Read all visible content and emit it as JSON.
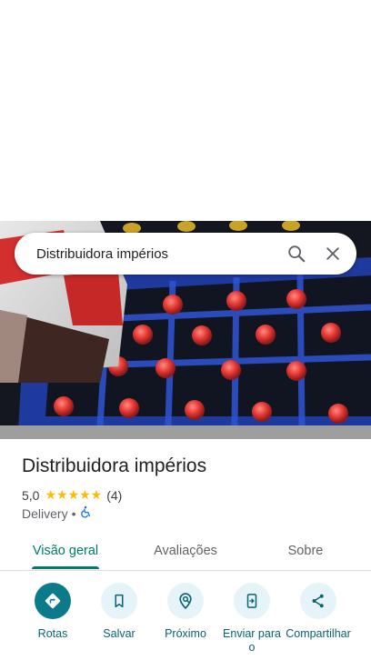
{
  "search": {
    "query": "Distribuidora impérios",
    "search_icon": "search-icon",
    "close_icon": "close-icon"
  },
  "place": {
    "name": "Distribuidora impérios",
    "rating": "5,0",
    "stars": "★★★★★",
    "review_count": "(4)",
    "category": "Delivery",
    "separator": "•",
    "accessibility_icon": "wheelchair-icon"
  },
  "tabs": [
    {
      "label": "Visão geral",
      "active": true
    },
    {
      "label": "Avaliações",
      "active": false
    },
    {
      "label": "Sobre",
      "active": false
    }
  ],
  "actions": [
    {
      "label": "Rotas",
      "icon": "directions-icon"
    },
    {
      "label": "Salvar",
      "icon": "bookmark-icon"
    },
    {
      "label": "Próximo",
      "icon": "nearby-icon"
    },
    {
      "label": "Enviar para o",
      "icon": "send-to-phone-icon"
    },
    {
      "label": "Compartilhar",
      "icon": "share-icon"
    }
  ],
  "colors": {
    "accent": "#00796b",
    "primary_action": "#0b7b8b",
    "action_bg": "#e6f4f9",
    "star": "#fbbc04"
  }
}
